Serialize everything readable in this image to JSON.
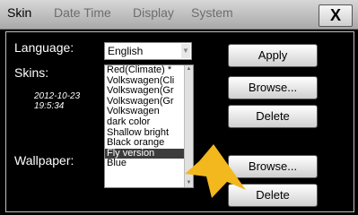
{
  "tabs": [
    {
      "label": "Skin"
    },
    {
      "label": "Date Time"
    },
    {
      "label": "Display"
    },
    {
      "label": "System"
    }
  ],
  "close_label": "X",
  "language": {
    "label": "Language:",
    "value": "English"
  },
  "skins": {
    "label": "Skins:",
    "date": "2012-10-23",
    "time": "19:5:34",
    "items": [
      "Red(Climate) *",
      "Volkswagen(Cli",
      "Volkswagen(Gr",
      "Volkswagen(Gr",
      "Volkswagen",
      "dark color",
      "Shallow bright",
      "Black orange",
      "Fly version",
      "Blue"
    ],
    "selected_index": 8
  },
  "wallpaper": {
    "label": "Wallpaper:"
  },
  "buttons": {
    "apply": "Apply",
    "browse1": "Browse...",
    "delete1": "Delete",
    "browse2": "Browse...",
    "delete2": "Delete"
  },
  "colors": {
    "pointer": "#f2b81d",
    "selection": "#3c3c3c"
  }
}
